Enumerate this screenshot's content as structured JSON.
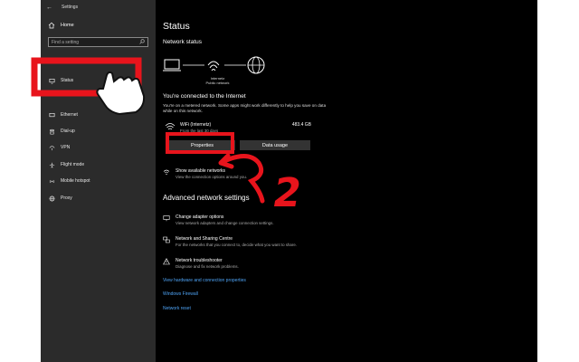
{
  "titlebar": {
    "back_glyph": "←",
    "title": "Settings"
  },
  "sidebar": {
    "home_label": "Home",
    "search_placeholder": "Find a setting",
    "items": [
      {
        "label": "Status",
        "icon": "globe-icon"
      },
      {
        "label": "Ethernet",
        "icon": "ethernet-icon"
      },
      {
        "label": "Dial-up",
        "icon": "phone-icon"
      },
      {
        "label": "VPN",
        "icon": "vpn-icon"
      },
      {
        "label": "Flight mode",
        "icon": "airplane-icon"
      },
      {
        "label": "Mobile hotspot",
        "icon": "hotspot-icon"
      },
      {
        "label": "Proxy",
        "icon": "globe-icon"
      }
    ]
  },
  "main": {
    "title": "Status",
    "network_status_heading": "Network status",
    "diagram_label_1": "Internetz",
    "diagram_label_2": "Public network",
    "connected_heading": "You're connected to the Internet",
    "metered_text": "You're on a metered network. Some apps might work differently to help you save on data while on this network.",
    "wifi_name": "WiFi (Internetz)",
    "wifi_usage": "483.4 GB",
    "wifi_sub": "From the last 30 days",
    "properties_button": "Properties",
    "data_usage_button": "Data usage",
    "show_networks_title": "Show available networks",
    "show_networks_desc": "View the connection options around you.",
    "advanced_heading": "Advanced network settings",
    "adapter_title": "Change adapter options",
    "adapter_desc": "View network adapters and change connection settings.",
    "sharing_title": "Network and Sharing Centre",
    "sharing_desc": "For the networks that you connect to, decide what you want to share.",
    "troubleshooter_title": "Network troubleshooter",
    "troubleshooter_desc": "Diagnose and fix network problems.",
    "link_hw_props": "View hardware and connection properties",
    "link_firewall": "Windows Firewall",
    "link_reset": "Network reset"
  },
  "annotations": {
    "step2_number": "2",
    "red": "#e8141c"
  }
}
